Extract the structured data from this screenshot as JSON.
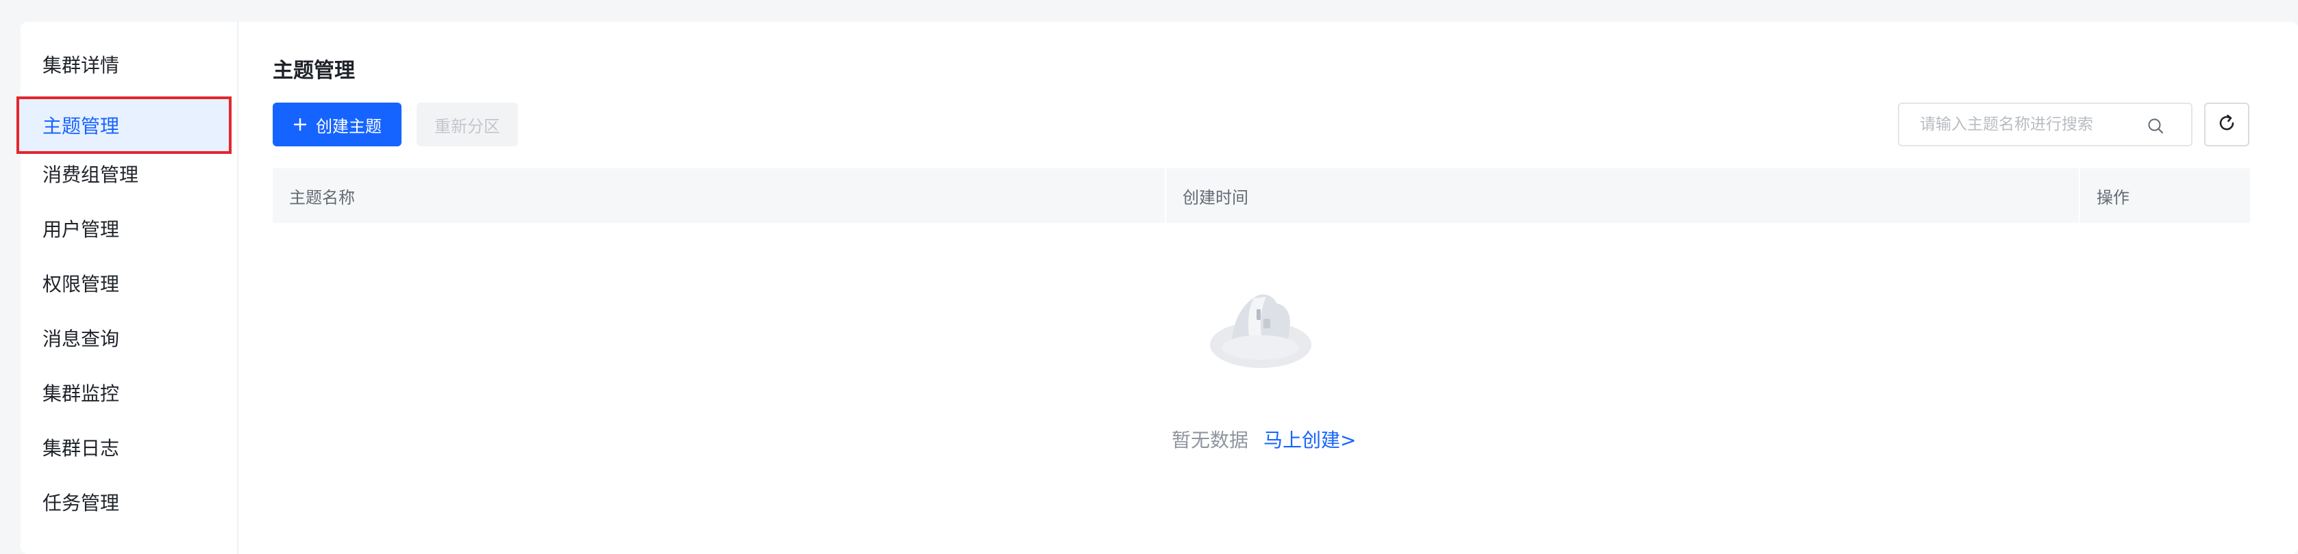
{
  "sidebar": {
    "items": [
      {
        "label": "集群详情"
      },
      {
        "label": "主题管理"
      },
      {
        "label": "消费组管理"
      },
      {
        "label": "用户管理"
      },
      {
        "label": "权限管理"
      },
      {
        "label": "消息查询"
      },
      {
        "label": "集群监控"
      },
      {
        "label": "集群日志"
      },
      {
        "label": "任务管理"
      }
    ],
    "active_index": 1
  },
  "main": {
    "title": "主题管理",
    "create_button": "创建主题",
    "repartition_button": "重新分区",
    "search": {
      "placeholder": "请输入主题名称进行搜索",
      "value": ""
    },
    "table": {
      "columns": [
        "主题名称",
        "创建时间",
        "操作"
      ],
      "rows": []
    },
    "empty": {
      "text": "暂无数据",
      "link": "马上创建>"
    }
  },
  "colors": {
    "accent": "#1664ff",
    "active_bg": "#e8f1ff",
    "highlight_border": "#e3262d"
  },
  "icons": [
    "plus-icon",
    "search-icon",
    "refresh-icon",
    "empty-data-icon"
  ]
}
